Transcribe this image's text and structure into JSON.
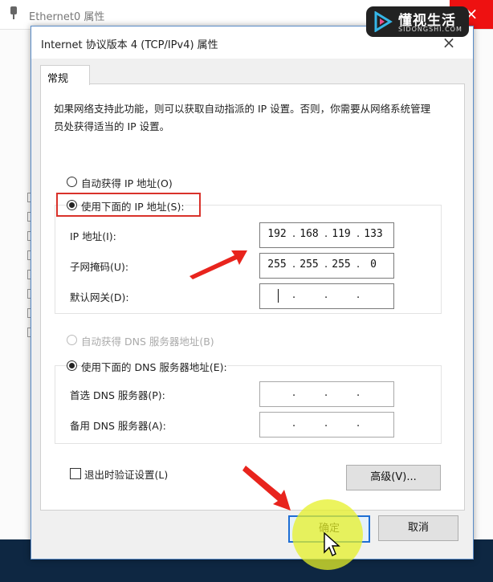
{
  "background_window": {
    "title": "Ethernet0 属性",
    "close_glyph": "×"
  },
  "watermark": {
    "brand": "懂视生活",
    "domain": "SIDONGSHI.COM"
  },
  "dialog": {
    "title": "Internet 协议版本 4 (TCP/IPv4) 属性",
    "close_glyph": "×",
    "tab_general": "常规",
    "description": "如果网络支持此功能，则可以获取自动指派的 IP 设置。否则，你需要从网络系统管理员处获得适当的 IP 设置。",
    "ip": {
      "auto_label": "自动获得 IP 地址(O)",
      "auto_selected": false,
      "manual_label": "使用下面的 IP 地址(S):",
      "manual_selected": true,
      "address_label": "IP 地址(I):",
      "address": [
        "192",
        "168",
        "119",
        "133"
      ],
      "subnet_label": "子网掩码(U):",
      "subnet": [
        "255",
        "255",
        "255",
        "0"
      ],
      "gateway_label": "默认网关(D):",
      "gateway": [
        "",
        "",
        "",
        ""
      ]
    },
    "dns": {
      "auto_label": "自动获得 DNS 服务器地址(B)",
      "auto_selected": false,
      "manual_label": "使用下面的 DNS 服务器地址(E):",
      "manual_selected": true,
      "preferred_label": "首选 DNS 服务器(P):",
      "preferred": [
        "",
        "",
        "",
        ""
      ],
      "alternate_label": "备用 DNS 服务器(A):",
      "alternate": [
        "",
        "",
        "",
        ""
      ]
    },
    "validate_label": "退出时验证设置(L)",
    "validate_checked": false,
    "advanced_button": "高级(V)...",
    "ok_button": "确定",
    "cancel_button": "取消"
  },
  "colors": {
    "annotation_red": "#d9322b",
    "click_highlight": "#e6f028"
  }
}
